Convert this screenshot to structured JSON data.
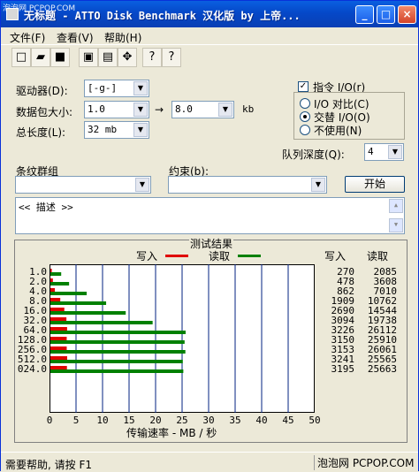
{
  "window": {
    "watermark": "泡泡网 PCPOP.COM",
    "title": "无标题 - ATTO Disk Benchmark 汉化版 by 上帝...",
    "controls": [
      "_",
      "□",
      "×"
    ]
  },
  "menu": {
    "items": [
      "文件(F)",
      "查看(V)",
      "帮助(H)"
    ]
  },
  "toolbar": {
    "icons": [
      "new-icon",
      "open-icon",
      "save-icon",
      "print-icon",
      "preview-icon",
      "move-icon",
      "help-icon",
      "context-help-icon"
    ],
    "glyphs": [
      "□",
      "▰",
      "■",
      "▣",
      "▤",
      "✥",
      "?",
      "?"
    ]
  },
  "settings": {
    "drive_label": "驱动器(D):",
    "drive_value": "[-g-]",
    "packet_label": "数据包大小:",
    "packet_from": "1.0",
    "packet_to": "8.0",
    "packet_unit": "kb",
    "total_label": "总长度(L):",
    "total_value": "32 mb",
    "direct_io_label": "指令 I/O(r)",
    "direct_io_checked": true,
    "io_compare_label": "I/O 对比(C)",
    "overlap_label": "交替 I/O(O)",
    "disable_label": "不使用(N)",
    "queue_label": "队列深度(Q):",
    "queue_value": "4",
    "stripe_label": "条纹群组",
    "constraint_label": "约束(b):",
    "start_button": "开始",
    "description": "<< 描述 >>"
  },
  "results": {
    "title": "测试结果",
    "write_legend": "写入",
    "read_legend": "读取",
    "write_header": "写入",
    "read_header": "读取",
    "xlabel": "传输速率 - MB / 秒"
  },
  "chart_data": {
    "type": "bar",
    "categories": [
      "1.0",
      "2.0",
      "4.0",
      "8.0",
      "16.0",
      "32.0",
      "64.0",
      "128.0",
      "256.0",
      "512.0",
      "024.0"
    ],
    "series": [
      {
        "name": "写入",
        "values": [
          270,
          478,
          862,
          1909,
          2690,
          3094,
          3226,
          3150,
          3153,
          3241,
          3195
        ]
      },
      {
        "name": "读取",
        "values": [
          2085,
          3608,
          7010,
          10762,
          14544,
          19738,
          26112,
          25910,
          26061,
          25565,
          25663
        ]
      }
    ],
    "xlim": [
      0,
      50
    ],
    "xticks": [
      0,
      5,
      10,
      15,
      20,
      25,
      30,
      35,
      40,
      45,
      50
    ],
    "write_color": "#e00000",
    "read_color": "#008000"
  },
  "status": {
    "left": "需要帮助, 请按 F1",
    "right": "泡泡网 PCPOP.COM"
  }
}
